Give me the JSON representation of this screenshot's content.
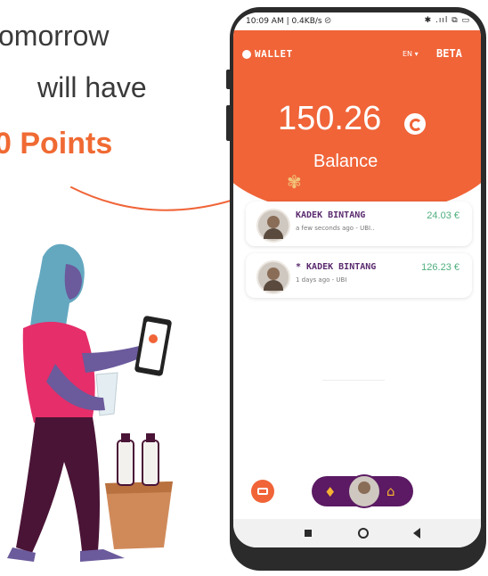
{
  "headline": {
    "line1": "omorrow",
    "line2": "will have",
    "line3": "0 Points"
  },
  "status_bar": {
    "time": "10:09 AM | 0.4KB/s ⦼",
    "icons": "✱ .ııl ⧉ ▭"
  },
  "app": {
    "title": "WALLET",
    "language": "EN ▾",
    "badge": "BETA"
  },
  "balance": {
    "amount": "150.26",
    "label": "Balance"
  },
  "transactions": [
    {
      "name": "KADEK BINTANG",
      "meta": "a few seconds ago - UBI..",
      "amount": "24.03 €"
    },
    {
      "name": "* KADEK BINTANG",
      "meta": "1 days ago - UBI",
      "amount": "126.23 €"
    }
  ],
  "colors": {
    "accent": "#f06438",
    "headline_highlight": "#f06a33",
    "nav_pill": "#5b1a63",
    "amount_green": "#4fae7e",
    "name_purple": "#5a2a6e"
  },
  "icons": [
    "wallet-logo-icon",
    "coin-icon",
    "wheat-icon",
    "camera-icon",
    "bell-icon",
    "home-icon"
  ]
}
